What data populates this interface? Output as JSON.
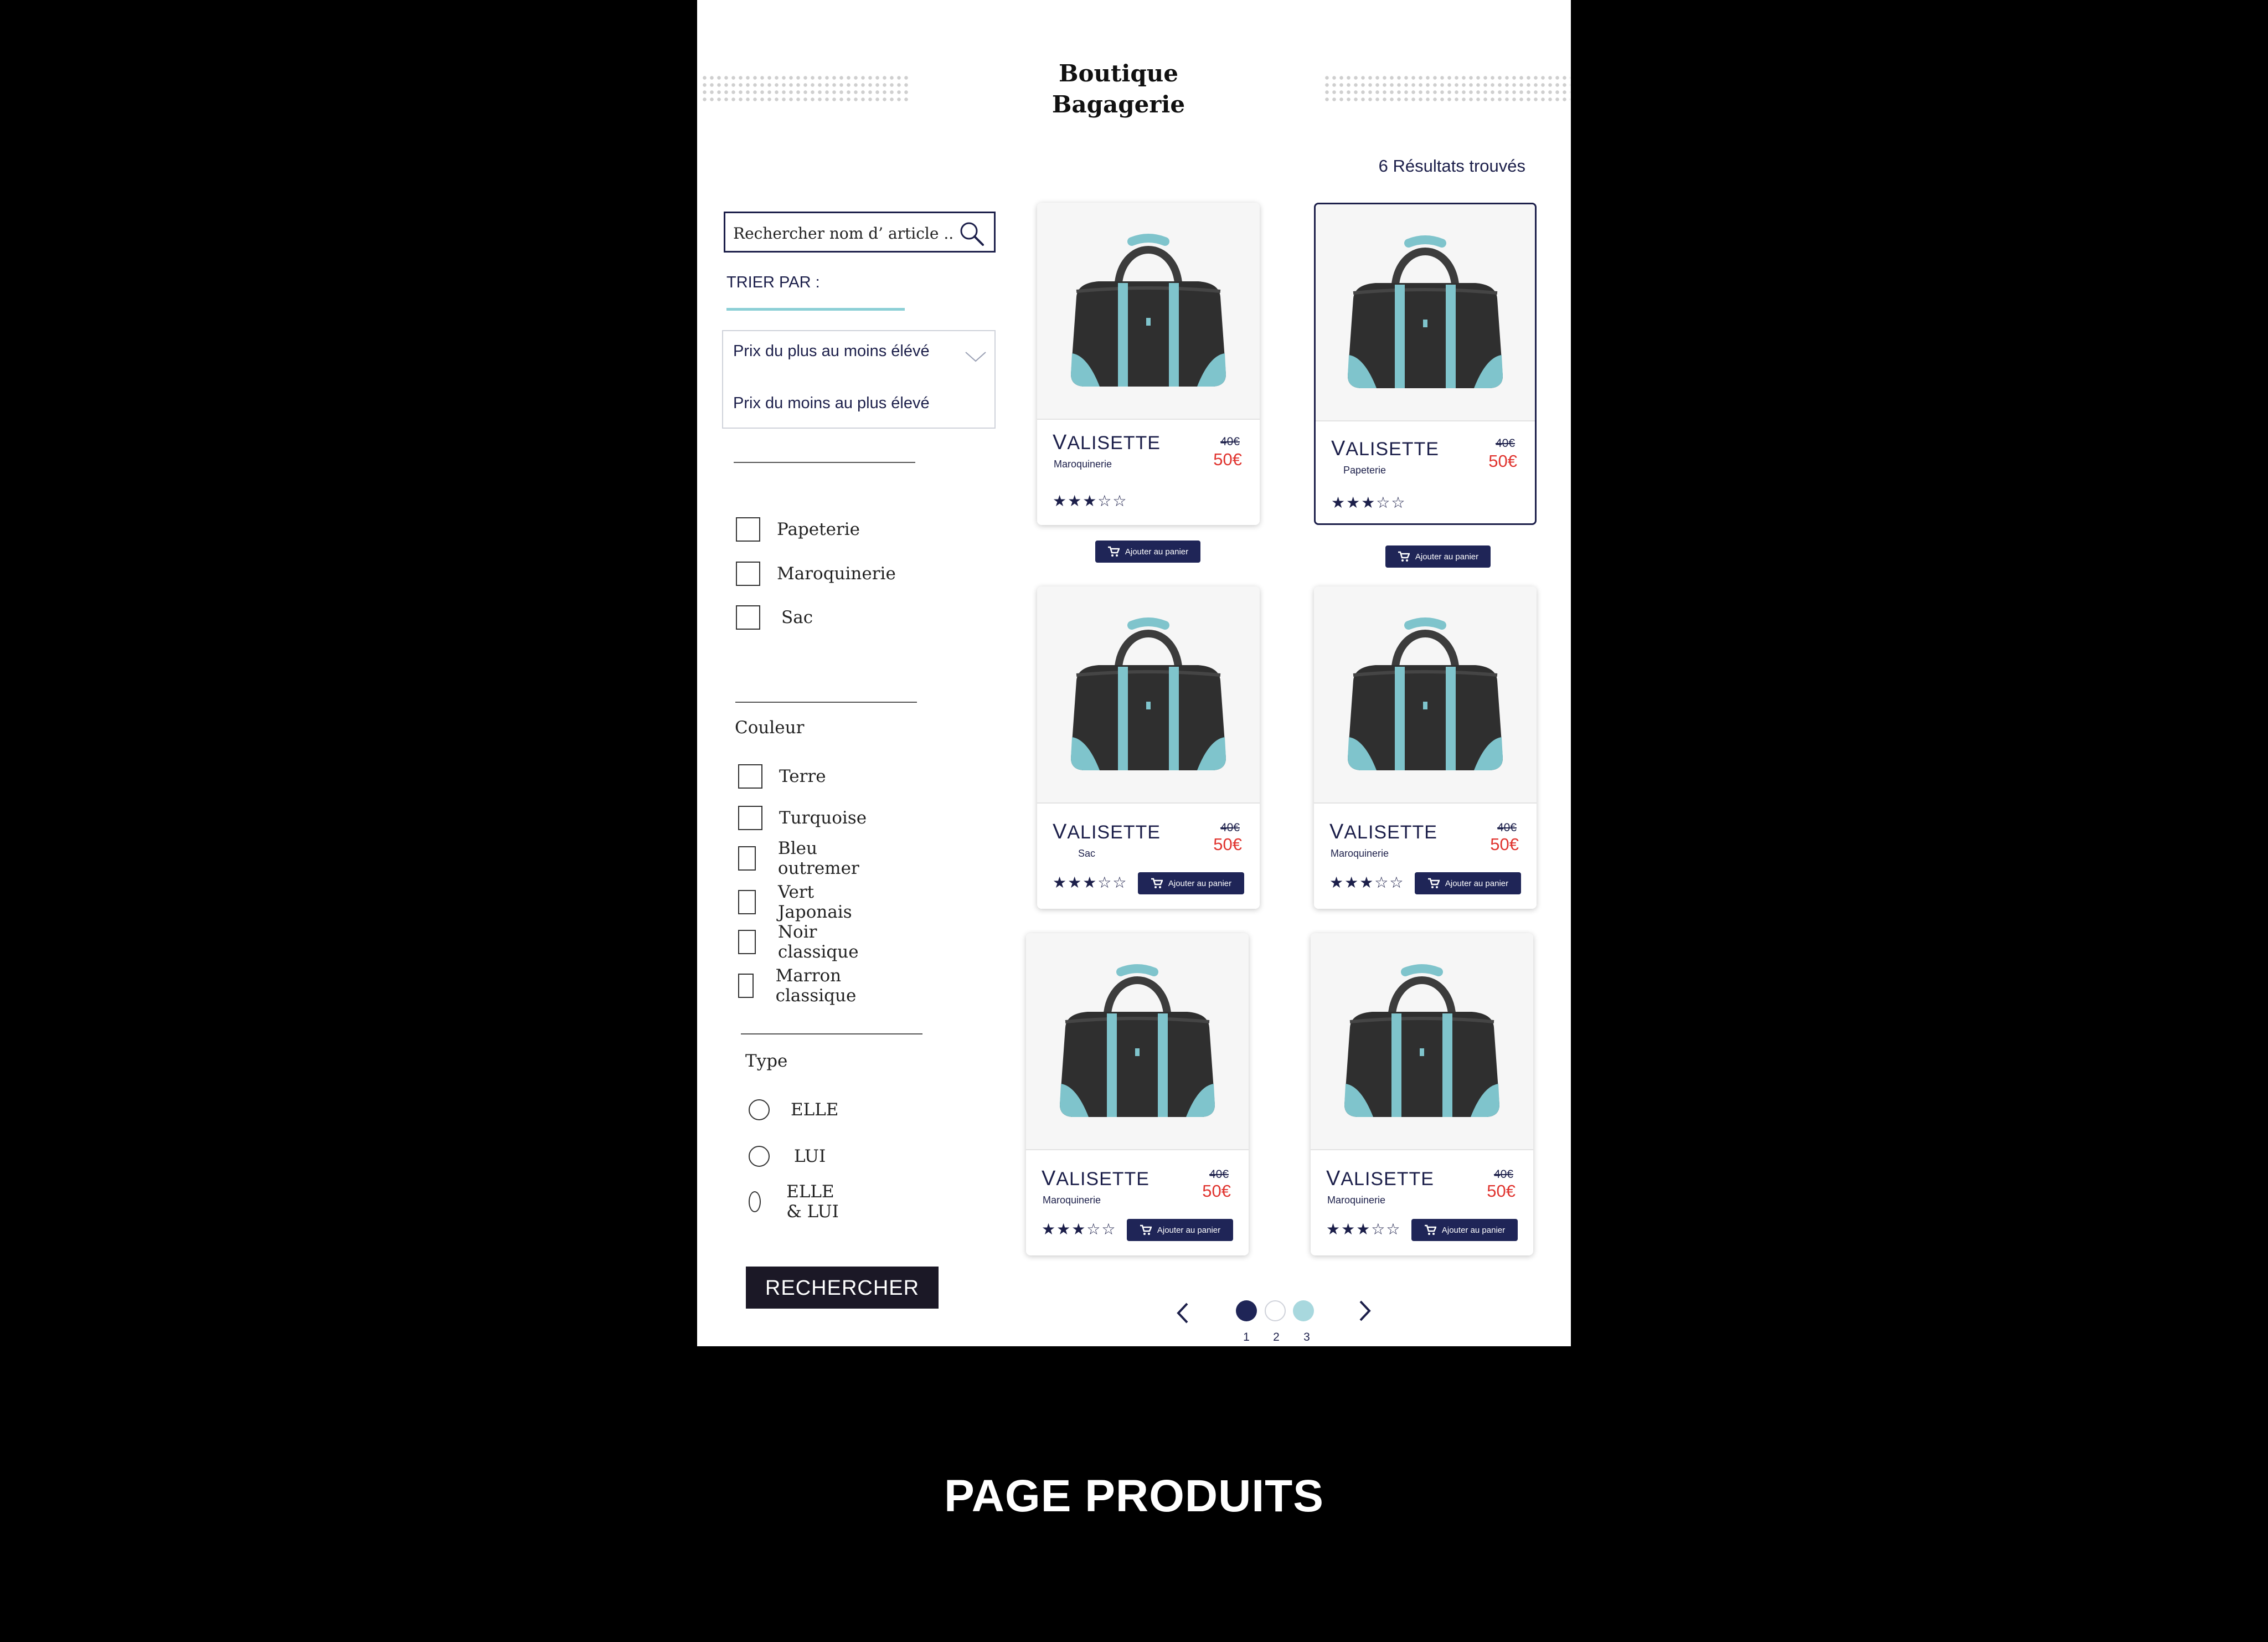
{
  "header": {
    "title_line1": "Boutique",
    "title_line2": "Bagagerie",
    "results": "6 Résultats trouvés"
  },
  "search": {
    "placeholder": "Rechercher nom d’ article ..."
  },
  "sort": {
    "label": "TRIER PAR :",
    "options": [
      "Prix du plus au moins élévé",
      "Prix du moins au plus élevé"
    ]
  },
  "categories": [
    "Papeterie",
    "Maroquinerie",
    "Sac"
  ],
  "colors": {
    "title": "Couleur",
    "items": [
      "Terre",
      "Turquoise",
      "Bleu outremer",
      "Vert Japonais",
      "Noir classique",
      "Marron classique"
    ]
  },
  "type": {
    "title": "Type",
    "items": [
      "ELLE",
      "LUI",
      "ELLE &  LUI"
    ]
  },
  "search_button": "RECHERCHER",
  "products": [
    {
      "name_first": "V",
      "name_rest": "ALISETTE",
      "category": "Maroquinerie",
      "old_price": "40€",
      "price": "50€",
      "stars": "★★★☆☆",
      "cart_label": "Ajouter au panier"
    },
    {
      "name_first": "V",
      "name_rest": "ALISETTE",
      "category": "Papeterie",
      "old_price": "40€",
      "price": "50€",
      "stars": "★★★☆☆",
      "cart_label": "Ajouter au panier"
    },
    {
      "name_first": "V",
      "name_rest": "ALISETTE",
      "category": "Sac",
      "old_price": "40€",
      "price": "50€",
      "stars": "★★★☆☆",
      "cart_label": "Ajouter au panier"
    },
    {
      "name_first": "V",
      "name_rest": "ALISETTE",
      "category": "Maroquinerie",
      "old_price": "40€",
      "price": "50€",
      "stars": "★★★☆☆",
      "cart_label": "Ajouter au panier"
    },
    {
      "name_first": "V",
      "name_rest": "ALISETTE",
      "category": "Maroquinerie",
      "old_price": "40€",
      "price": "50€",
      "stars": "★★★☆☆",
      "cart_label": "Ajouter au panier"
    },
    {
      "name_first": "V",
      "name_rest": "ALISETTE",
      "category": "Maroquinerie",
      "old_price": "40€",
      "price": "50€",
      "stars": "★★★☆☆",
      "cart_label": "Ajouter au panier"
    }
  ],
  "pagination": {
    "pages": [
      "1",
      "2",
      "3"
    ],
    "current": "1"
  },
  "caption": "PAGE PRODUITS",
  "theme": {
    "navy": "#1c1f4a",
    "turquoise": "#8ccfd6",
    "price_red": "#e0342f",
    "button_dark": "#1b1826"
  }
}
